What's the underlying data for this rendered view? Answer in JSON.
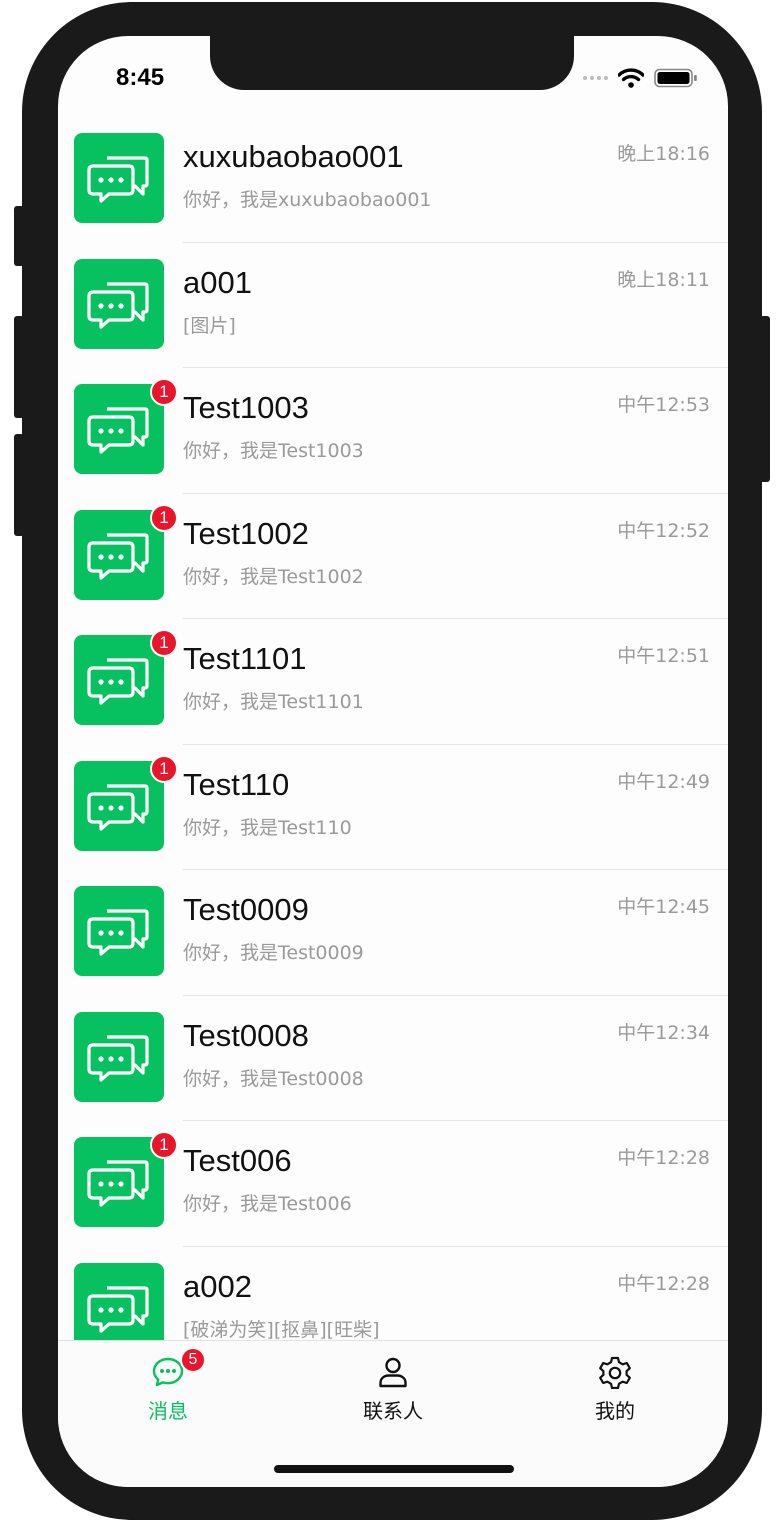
{
  "status_bar": {
    "time": "8:45"
  },
  "colors": {
    "brand_green": "#07c160",
    "badge_red": "#e8162d"
  },
  "chats": [
    {
      "name": "xuxubaobao001",
      "preview": "你好，我是xuxubaobao001",
      "time": "晚上18:16",
      "unread": ""
    },
    {
      "name": "a001",
      "preview": "[图片]",
      "time": "晚上18:11",
      "unread": ""
    },
    {
      "name": "Test1003",
      "preview": "你好，我是Test1003",
      "time": "中午12:53",
      "unread": "1"
    },
    {
      "name": "Test1002",
      "preview": "你好，我是Test1002",
      "time": "中午12:52",
      "unread": "1"
    },
    {
      "name": "Test1101",
      "preview": "你好，我是Test1101",
      "time": "中午12:51",
      "unread": "1"
    },
    {
      "name": "Test110",
      "preview": "你好，我是Test110",
      "time": "中午12:49",
      "unread": "1"
    },
    {
      "name": "Test0009",
      "preview": "你好，我是Test0009",
      "time": "中午12:45",
      "unread": ""
    },
    {
      "name": "Test0008",
      "preview": "你好，我是Test0008",
      "time": "中午12:34",
      "unread": ""
    },
    {
      "name": "Test006",
      "preview": "你好，我是Test006",
      "time": "中午12:28",
      "unread": "1"
    },
    {
      "name": "a002",
      "preview": "[破涕为笑][抠鼻][旺柴]",
      "time": "中午12:28",
      "unread": ""
    }
  ],
  "avatar_icon": "chat-bubbles-icon",
  "tabs": [
    {
      "label": "消息",
      "icon": "message-icon",
      "badge": "5",
      "active": true
    },
    {
      "label": "联系人",
      "icon": "person-icon",
      "badge": "",
      "active": false
    },
    {
      "label": "我的",
      "icon": "gear-icon",
      "badge": "",
      "active": false
    }
  ]
}
